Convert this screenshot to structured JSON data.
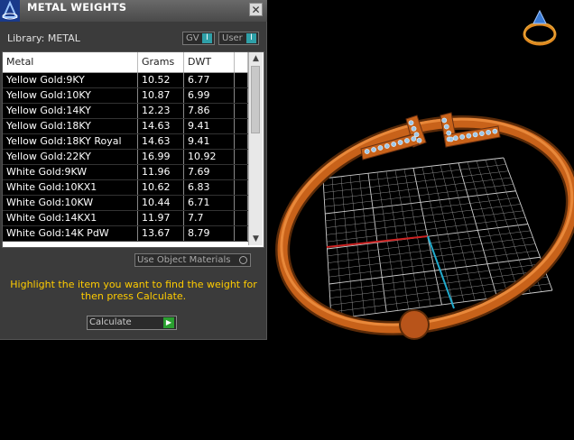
{
  "window": {
    "title": "METAL WEIGHTS",
    "close_label": "✕"
  },
  "library": {
    "label": "Library: METAL",
    "toggles": [
      {
        "label": "GV",
        "state": "I"
      },
      {
        "label": "User",
        "state": "I"
      }
    ]
  },
  "table": {
    "columns": [
      "Metal",
      "Grams",
      "DWT"
    ],
    "rows": [
      {
        "metal": "Yellow Gold:9KY",
        "grams": "10.52",
        "dwt": "6.77"
      },
      {
        "metal": "Yellow Gold:10KY",
        "grams": "10.87",
        "dwt": "6.99"
      },
      {
        "metal": "Yellow Gold:14KY",
        "grams": "12.23",
        "dwt": "7.86"
      },
      {
        "metal": "Yellow Gold:18KY",
        "grams": "14.63",
        "dwt": "9.41"
      },
      {
        "metal": "Yellow Gold:18KY Royal",
        "grams": "14.63",
        "dwt": "9.41"
      },
      {
        "metal": "Yellow Gold:22KY",
        "grams": "16.99",
        "dwt": "10.92"
      },
      {
        "metal": "White Gold:9KW",
        "grams": "11.96",
        "dwt": "7.69"
      },
      {
        "metal": "White Gold:10KX1",
        "grams": "10.62",
        "dwt": "6.83"
      },
      {
        "metal": "White Gold:10KW",
        "grams": "10.44",
        "dwt": "6.71"
      },
      {
        "metal": "White Gold:14KX1",
        "grams": "11.97",
        "dwt": "7.7"
      },
      {
        "metal": "White Gold:14K PdW",
        "grams": "13.67",
        "dwt": "8.79"
      }
    ],
    "scroll_up": "▲",
    "scroll_down": "▼"
  },
  "use_object_materials": "Use Object Materials",
  "instructions": "Highlight the item you want to find the weight for then press Calculate.",
  "calculate": {
    "label": "Calculate",
    "arrow": "▶"
  },
  "colors": {
    "panel_bg": "#3b3b3b",
    "instruction_text": "#ffcc00",
    "ring": "#c8621a",
    "grid": "#bbbbbb",
    "axis_x": "#cc2222",
    "axis_y": "#22aacc"
  }
}
